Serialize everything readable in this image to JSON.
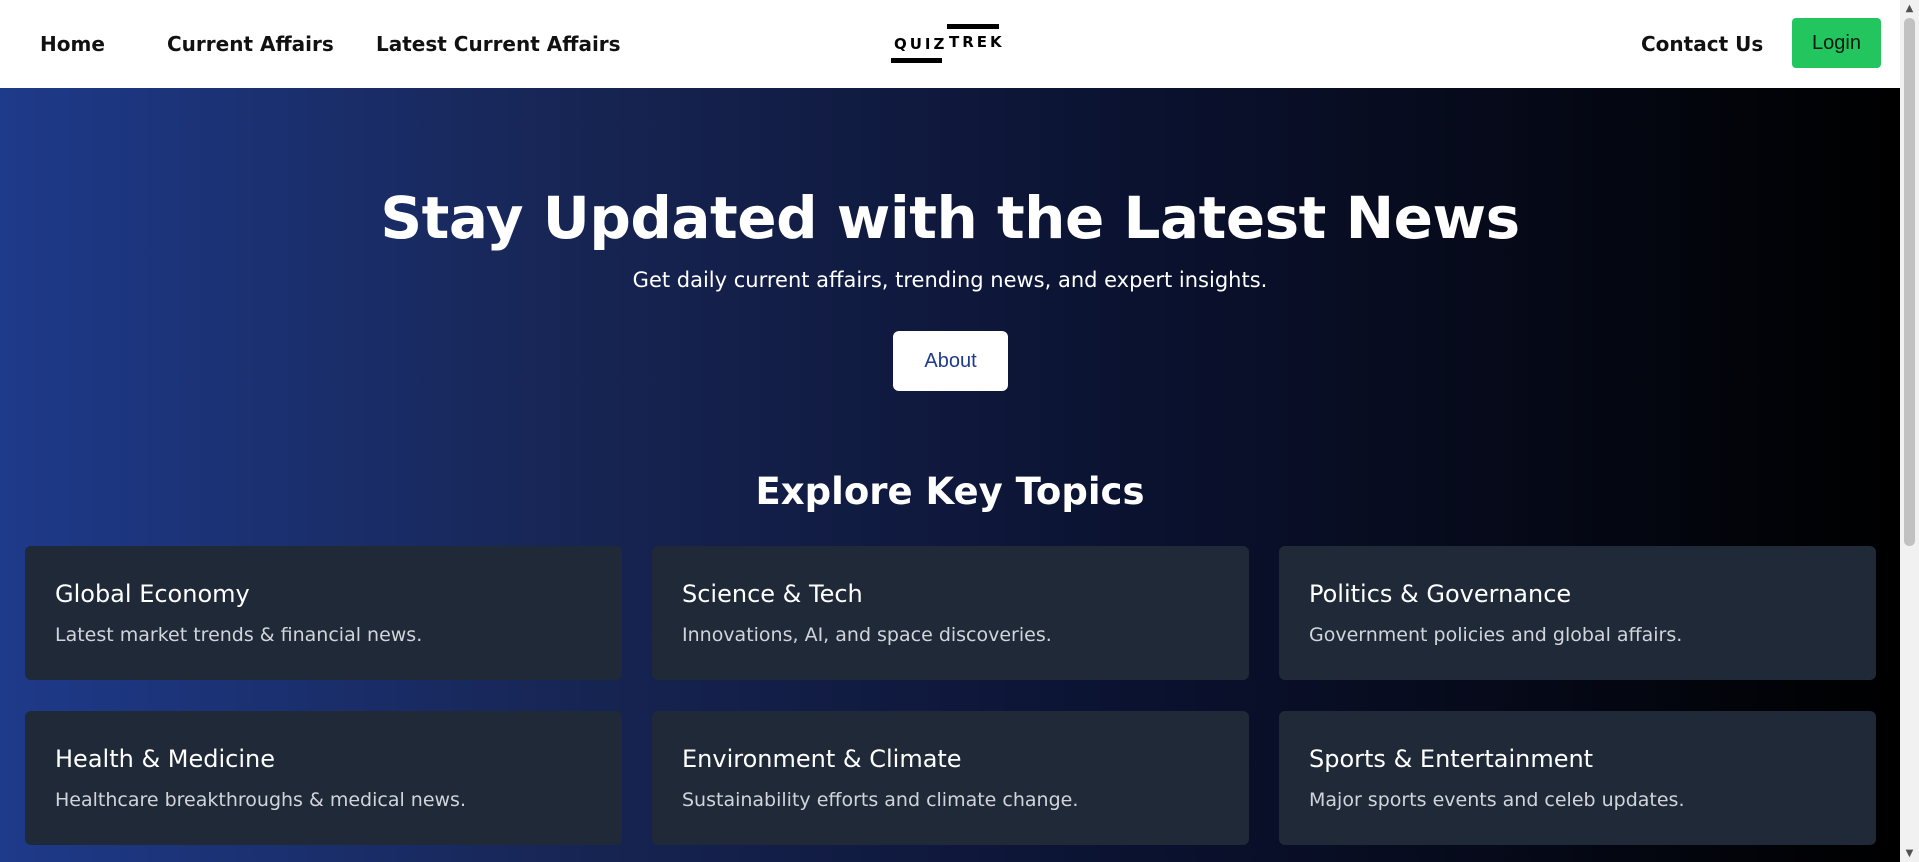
{
  "nav": {
    "links": [
      {
        "label": "Home"
      },
      {
        "label": "Current Affairs"
      },
      {
        "label": "Latest Current Affairs"
      }
    ],
    "logo": {
      "word1": "QUIZ",
      "word2": "TREK"
    },
    "contact_label": "Contact Us",
    "login_label": "Login"
  },
  "hero": {
    "title": "Stay Updated with the Latest News",
    "subtitle": "Get daily current affairs, trending news, and expert insights.",
    "about_label": "About"
  },
  "topics": {
    "heading": "Explore Key Topics",
    "cards": [
      {
        "title": "Global Economy",
        "desc": "Latest market trends & financial news."
      },
      {
        "title": "Science & Tech",
        "desc": "Innovations, AI, and space discoveries."
      },
      {
        "title": "Politics & Governance",
        "desc": "Government policies and global affairs."
      },
      {
        "title": "Health & Medicine",
        "desc": "Healthcare breakthroughs & medical news."
      },
      {
        "title": "Environment & Climate",
        "desc": "Sustainability efforts and climate change."
      },
      {
        "title": "Sports & Entertainment",
        "desc": "Major sports events and celeb updates."
      }
    ]
  },
  "colors": {
    "login_bg": "#22c55e",
    "card_bg": "#1f2937",
    "hero_gradient_start": "#1e3a8a",
    "hero_gradient_end": "#000000"
  },
  "icons": {
    "scroll_up": "scroll-up-arrow-icon",
    "scroll_down": "scroll-down-arrow-icon"
  }
}
